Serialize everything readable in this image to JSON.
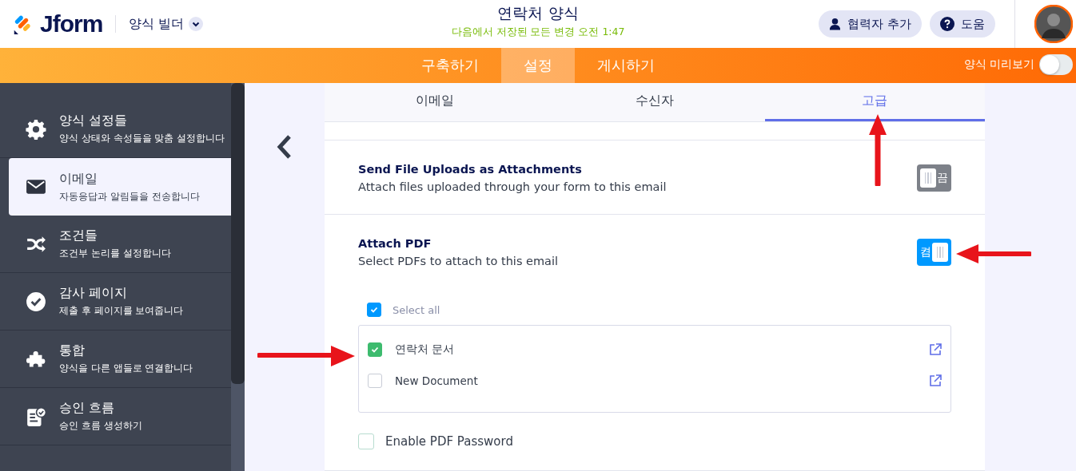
{
  "header": {
    "logo": "Jform",
    "builder_menu": "양식 빌더",
    "title": "연락처 양식",
    "save_status": "다음에서 저장된 모든 변경 오전 1:47",
    "buttons": [
      {
        "label": "협력자 추가",
        "kind": "user"
      },
      {
        "label": "도움",
        "kind": "help"
      }
    ]
  },
  "nav": {
    "tabs": [
      {
        "label": "구축하기",
        "selected": false
      },
      {
        "label": "설정",
        "selected": true
      },
      {
        "label": "게시하기",
        "selected": false
      }
    ],
    "preview": {
      "label": "양식 미리보기",
      "on": false
    }
  },
  "sidebar": {
    "items": [
      {
        "title": "양식 설정들",
        "subtitle": "양식 상태와 속성들을 맞춤 설정합니다",
        "kind": "gear",
        "selected": false
      },
      {
        "title": "이메일",
        "subtitle": "자동응답과 알림들을 전송합니다",
        "kind": "mail",
        "selected": true
      },
      {
        "title": "조건들",
        "subtitle": "조건부 논리를 설정합니다",
        "kind": "shuffle",
        "selected": false
      },
      {
        "title": "감사 페이지",
        "subtitle": "제출 후 페이지를 보여줍니다",
        "kind": "check",
        "selected": false
      },
      {
        "title": "통합",
        "subtitle": "양식을 다른 앱들로 연결합니다",
        "kind": "puzzle",
        "selected": false
      },
      {
        "title": "승인 흐름",
        "subtitle": "승인 흐름 생성하기",
        "kind": "approval",
        "selected": false
      }
    ]
  },
  "subtabs": [
    {
      "label": "이메일",
      "selected": false
    },
    {
      "label": "수신자",
      "selected": false
    },
    {
      "label": "고급",
      "selected": true
    }
  ],
  "settings": [
    {
      "title": "Send File Uploads as Attachments",
      "description": "Attach files uploaded through your form to this email",
      "toggle": {
        "on": false,
        "label": "끔"
      }
    },
    {
      "title": "Attach PDF",
      "description": "Select PDFs to attach to this email",
      "toggle": {
        "on": true,
        "label": "켬"
      }
    }
  ],
  "pdf": {
    "select_all": {
      "label": "Select all",
      "checked": true
    },
    "documents": [
      {
        "name": "연락처 문서",
        "checked": true
      },
      {
        "name": "New Document",
        "checked": false
      }
    ],
    "password": {
      "label": "Enable PDF Password",
      "checked": false
    }
  }
}
